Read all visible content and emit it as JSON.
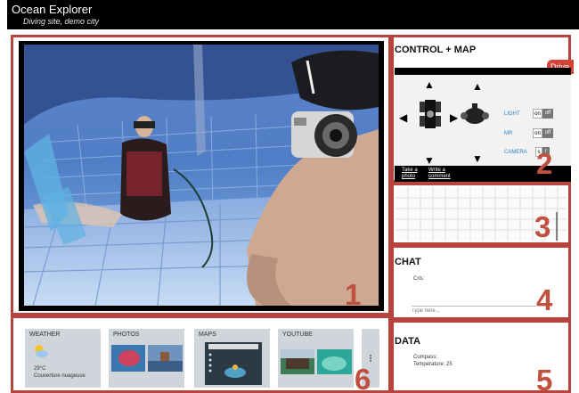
{
  "app": {
    "title": "Ocean Explorer",
    "subtitle": "Diving site, demo city"
  },
  "panels": {
    "numbers": [
      "1",
      "2",
      "3",
      "4",
      "5",
      "6"
    ]
  },
  "control": {
    "heading": "CONTROL + MAP",
    "drive_tab": "Drive",
    "light_label": "LIGHT",
    "mr_label": "MR",
    "camera_label": "CAMERA",
    "on": "on",
    "off": "off",
    "cam_a": "s",
    "cam_b": "r",
    "take_photo": "Take a photo",
    "write_comment": "Write a comment"
  },
  "chat": {
    "heading": "CHAT",
    "message": "Cris:",
    "placeholder": "Type here..."
  },
  "data": {
    "heading": "DATA",
    "compass_label": "Compass:",
    "temperature_label": "Temperature: 25"
  },
  "bottom_tiles": {
    "weather": {
      "label": "WEATHER",
      "temp": "29°C",
      "desc": "Couverture nuageuse"
    },
    "photos": {
      "label": "PHOTOS"
    },
    "maps": {
      "label": "MAPS"
    },
    "youtube": {
      "label": "YOUTUBE"
    }
  },
  "colors": {
    "frame": "#b8453d",
    "number": "#c0503f",
    "water": "#4a7fd0",
    "drive": "#d4433a"
  }
}
